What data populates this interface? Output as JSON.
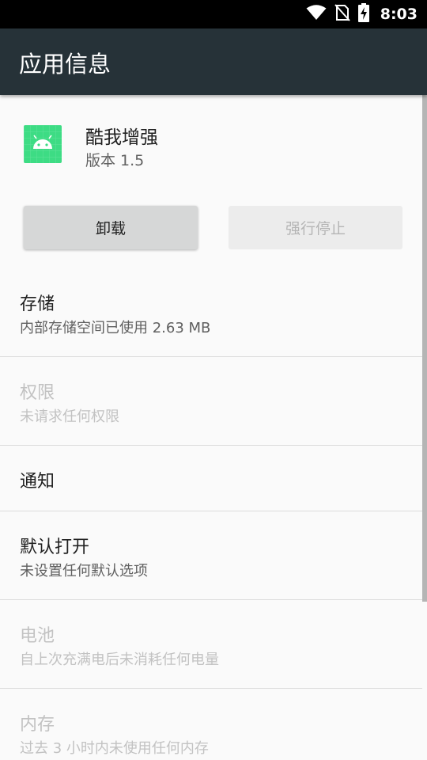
{
  "status_bar": {
    "time": "8:03",
    "icons": [
      "wifi-icon",
      "no-sim-icon",
      "battery-charging-icon"
    ]
  },
  "app_bar": {
    "title": "应用信息",
    "background": "#263238"
  },
  "app": {
    "name": "酷我增强",
    "version": "版本 1.5",
    "icon": "android-icon",
    "icon_color": "#3ddc84"
  },
  "buttons": {
    "uninstall": "卸载",
    "force_stop": "强行停止"
  },
  "settings": [
    {
      "title": "存储",
      "subtitle": "内部存储空间已使用 2.63 MB",
      "enabled": true
    },
    {
      "title": "权限",
      "subtitle": "未请求任何权限",
      "enabled": false
    },
    {
      "title": "通知",
      "subtitle": "",
      "enabled": true
    },
    {
      "title": "默认打开",
      "subtitle": "未设置任何默认选项",
      "enabled": true
    },
    {
      "title": "电池",
      "subtitle": "自上次充满电后未消耗任何电量",
      "enabled": false
    },
    {
      "title": "内存",
      "subtitle": "过去 3 小时内未使用任何内存",
      "enabled": false
    }
  ]
}
